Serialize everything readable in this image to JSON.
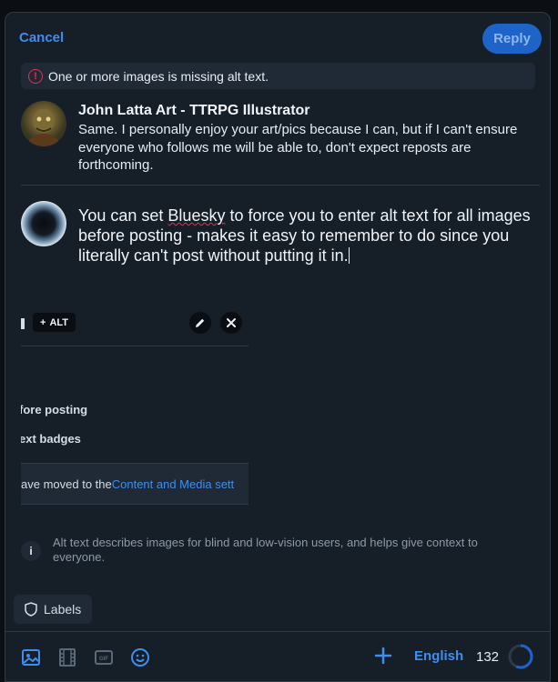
{
  "header": {
    "cancel_label": "Cancel",
    "reply_label": "Reply"
  },
  "warning": {
    "icon": "alert-circle-icon",
    "text": "One or more images is missing alt text."
  },
  "parent_post": {
    "author": "John Latta Art - TTRPG Illustrator",
    "text": "Same. I personally enjoy your art/pics because I can, but if I can't ensure everyone who follows me will be able to, don't expect reposts are forthcoming."
  },
  "composer": {
    "text_before": "You can set ",
    "text_spell": "Bluesky",
    "text_after": " to force you to enter alt text for all images before posting - makes it easy to remember to do since you literally can't post without putting it in."
  },
  "image_attachment": {
    "alt_label": "ALT",
    "screenshot_text_1": "fore posting",
    "screenshot_text_2": "ext badges",
    "screenshot_notice_prefix": "ave moved to the ",
    "screenshot_notice_link": "Content and Media sett"
  },
  "alt_info": {
    "icon": "info-icon",
    "text": "Alt text describes images for blind and low-vision users, and helps give context to everyone."
  },
  "labels_button": {
    "label": "Labels",
    "icon": "shield-icon"
  },
  "toolbar": {
    "icons": [
      "image-icon",
      "video-icon",
      "gif-icon",
      "emoji-icon"
    ],
    "add_icon": "plus-icon",
    "language": "English",
    "char_count": "132",
    "char_progress": 0.56
  },
  "colors": {
    "accent": "#3d8ef0",
    "reply_button": "#1e64c8",
    "warning": "#e0334f",
    "background": "#161e27"
  }
}
